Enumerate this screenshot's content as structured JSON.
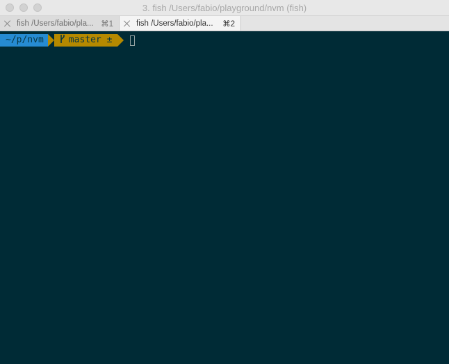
{
  "window": {
    "title": "3. fish  /Users/fabio/playground/nvm (fish)"
  },
  "tabs": [
    {
      "label": "fish  /Users/fabio/pla...",
      "shortcut": "⌘1",
      "active": false
    },
    {
      "label": "fish  /Users/fabio/pla...",
      "shortcut": "⌘2",
      "active": true
    }
  ],
  "terminal": {
    "prompt": {
      "path": "~/p/nvm",
      "branch": "master ±",
      "branch_icon": "git-branch-icon"
    }
  },
  "colors": {
    "background": "#002b36",
    "path_segment": "#268bd2",
    "git_segment": "#b58900",
    "segment_text": "#073642"
  }
}
